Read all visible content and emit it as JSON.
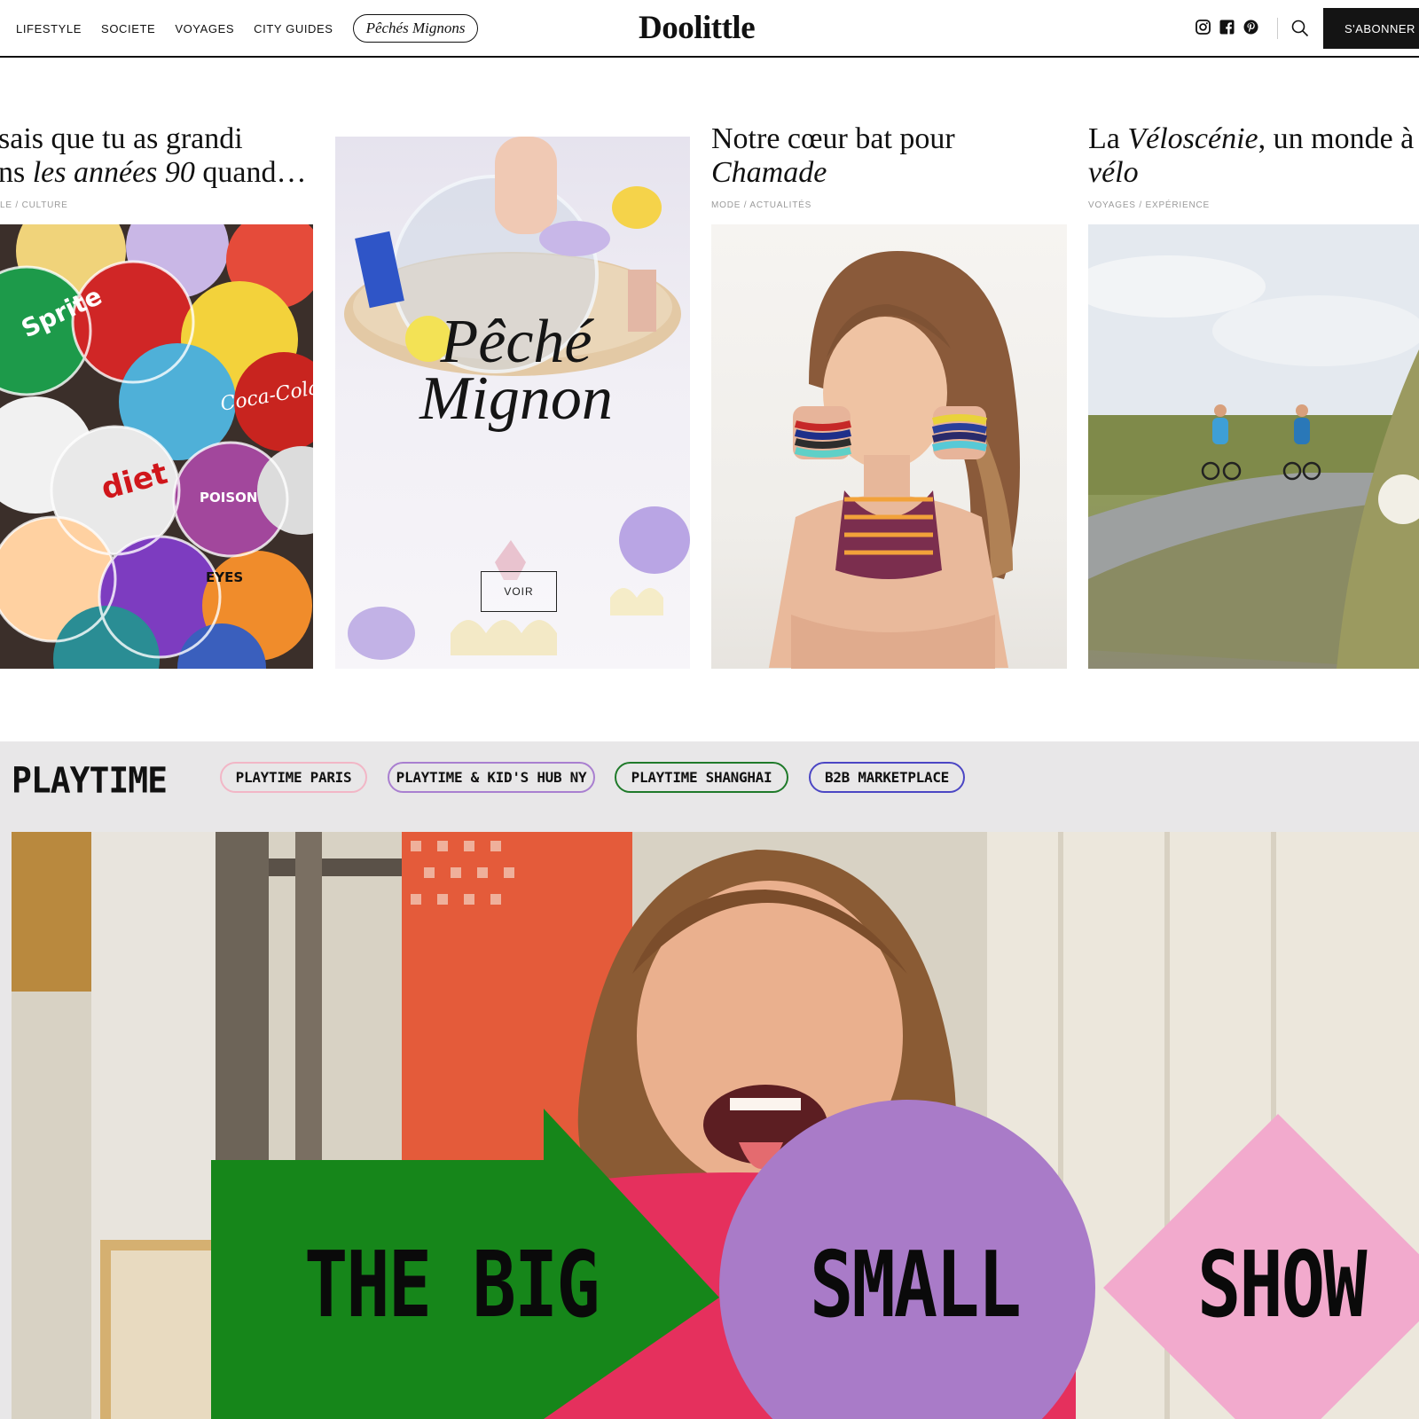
{
  "header": {
    "nav": [
      "LIFESTYLE",
      "SOCIETE",
      "VOYAGES",
      "CITY GUIDES"
    ],
    "special_pill": "Pêchés Mignons",
    "logo": "Doolittle",
    "subscribe": "S'ABONNER",
    "social_icons": [
      "instagram-icon",
      "facebook-icon",
      "pinterest-icon"
    ]
  },
  "articles": [
    {
      "title_a": "sais que tu as grandi",
      "title_b_pre": "ns ",
      "title_b_italic": "les années 90",
      "title_b_post": " quand…",
      "meta": "LE  / CULTURE"
    },
    {
      "overlay_line1": "Pêché",
      "overlay_line2": "Mignon",
      "button": "VOIR"
    },
    {
      "title_a": "Notre cœur bat pour",
      "title_b_italic": "Chamade",
      "meta": "MODE  / ACTUALITÉS"
    },
    {
      "title_a_pre": "La ",
      "title_a_italic": "Véloscénie",
      "title_a_post": ", un monde à",
      "title_b_italic": "vélo",
      "meta": "VOYAGES  / EXPÉRIENCE"
    }
  ],
  "playtime": {
    "logo": "PLAYTIME",
    "pills": [
      {
        "label": "PLAYTIME PARIS",
        "color": "#f2b6c6"
      },
      {
        "label": "PLAYTIME & KID'S HUB NY",
        "color": "#a97fd0"
      },
      {
        "label": "PLAYTIME SHANGHAI",
        "color": "#1f7a2a"
      },
      {
        "label": "B2B MARKETPLACE",
        "color": "#4b46c4"
      }
    ],
    "hero_words": [
      "THE BIG",
      "SMALL",
      "SHOW"
    ],
    "shape_colors": {
      "arrow": "#16861a",
      "circle": "#a97bc8",
      "diamond": "#f2aacd"
    }
  }
}
